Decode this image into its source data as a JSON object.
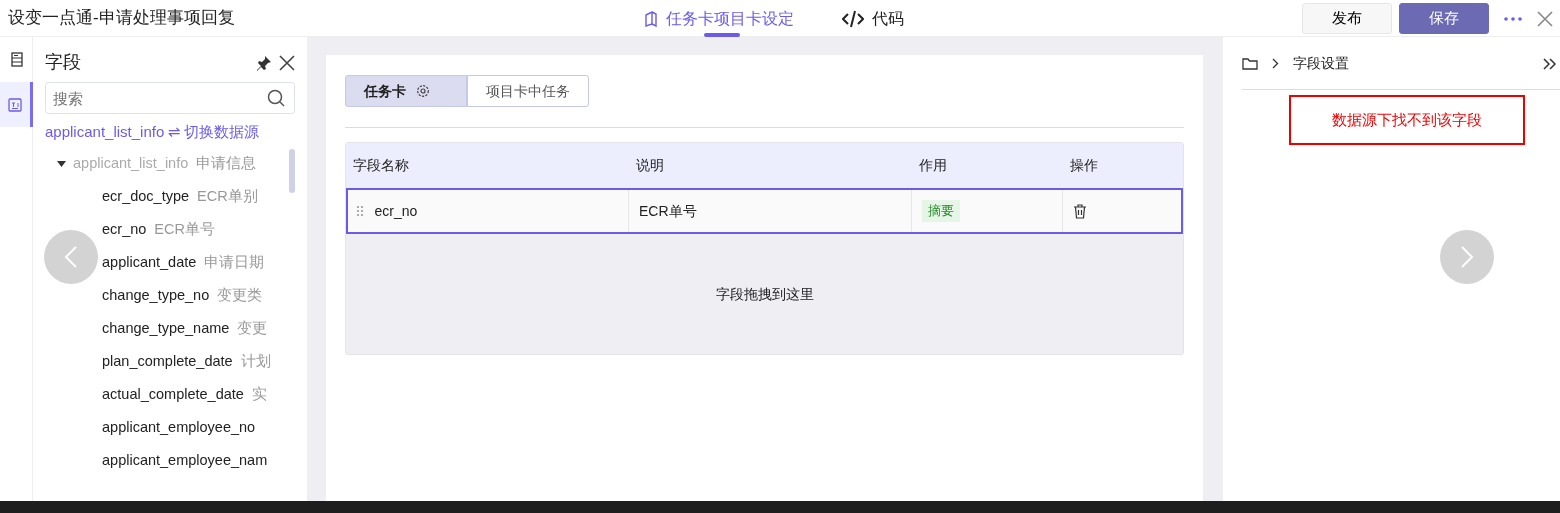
{
  "window": {
    "title": "设变一点通-申请处理事项回复"
  },
  "top_tabs": [
    {
      "label": "任务卡项目卡设定",
      "kind": "book",
      "selected": true
    },
    {
      "label": "代码",
      "kind": "code",
      "selected": false
    }
  ],
  "top_buttons": [
    {
      "label": "发布",
      "kind": "default"
    },
    {
      "label": "保存",
      "kind": "primary"
    }
  ],
  "rail": [
    {
      "kind": "form",
      "selected": false
    },
    {
      "kind": "fields",
      "selected": true
    }
  ],
  "fields_panel": {
    "title": "字段",
    "search": {
      "placeholder": "搜索"
    },
    "source": "applicant_list_info",
    "switch_label": "⇌ 切换数据源",
    "tree": [
      {
        "name": "applicant_list_info",
        "desc": "申请信息",
        "expanded": true,
        "children": [
          {
            "name": "ecr_doc_type",
            "desc": "ECR单别"
          },
          {
            "name": "ecr_no",
            "desc": "ECR单号"
          },
          {
            "name": "applicant_date",
            "desc": "申请日期"
          },
          {
            "name": "change_type_no",
            "desc": "变更类"
          },
          {
            "name": "change_type_name",
            "desc": "变更"
          },
          {
            "name": "plan_complete_date",
            "desc": "计划"
          },
          {
            "name": "actual_complete_date",
            "desc": "实"
          },
          {
            "name": "applicant_employee_no"
          },
          {
            "name": "applicant_employee_nam"
          }
        ]
      }
    ]
  },
  "card_tabs": [
    {
      "label": "任务卡",
      "gear": true,
      "selected": true
    },
    {
      "label": "项目卡中任务",
      "gear": false,
      "selected": false
    }
  ],
  "table": {
    "columns": [
      "字段名称",
      "说明",
      "作用",
      "操作"
    ],
    "rows": [
      {
        "name": "ecr_no",
        "desc": "ECR单号",
        "role": "摘要",
        "selected": true
      }
    ],
    "drop_hint": "字段拖拽到这里"
  },
  "right_panel": {
    "breadcrumb": "字段设置",
    "error": "数据源下找不到该字段"
  }
}
